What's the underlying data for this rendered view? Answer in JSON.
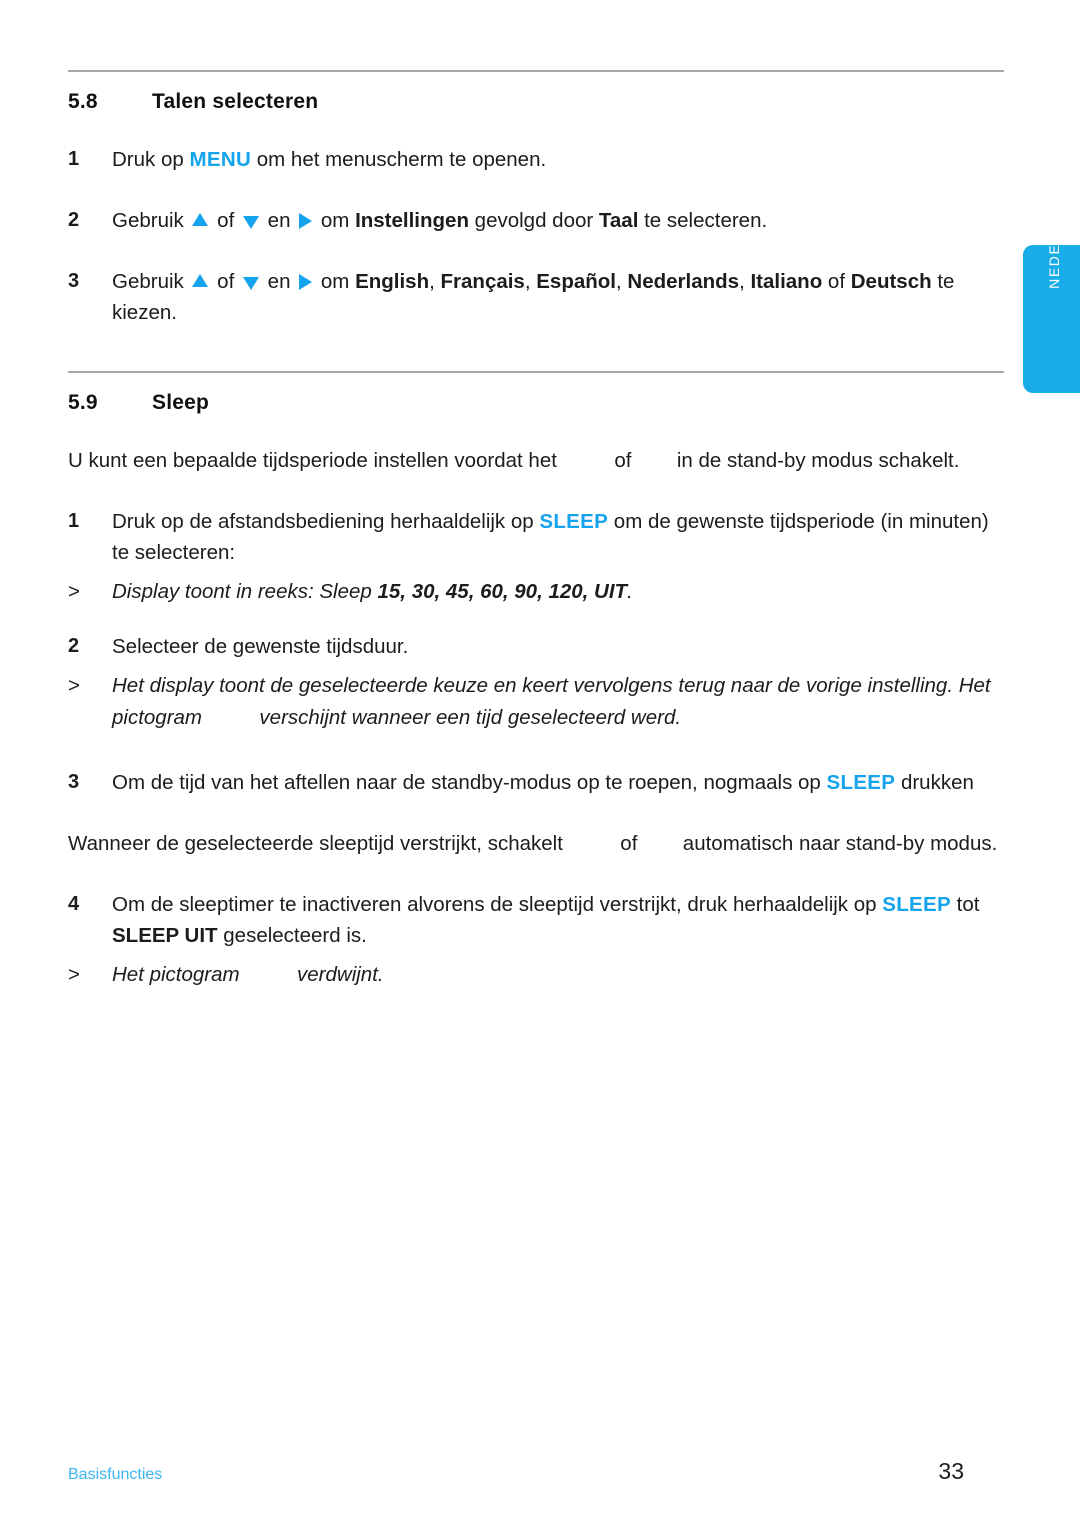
{
  "page": {
    "language_tab": "NEDERLANDS",
    "accent_color": "#14a3ec",
    "rule_color": "#a8a8a8"
  },
  "sections": [
    {
      "number": "5.8",
      "title": "Talen selecteren"
    },
    {
      "number": "5.9",
      "title": "Sleep"
    }
  ],
  "s58": {
    "step1": {
      "num": "1",
      "pre": "Druk op ",
      "key": "MENU",
      "post": " om het menuscherm te openen."
    },
    "step2": {
      "num": "2",
      "t1": "Gebruik ",
      "t2": " of ",
      "t3": " en ",
      "t4": " om ",
      "b1": "Instellingen",
      "t5": " gevolgd door ",
      "b2": "Taal",
      "t6": " te selecteren."
    },
    "step3": {
      "num": "3",
      "t1": "Gebruik ",
      "t2": " of ",
      "t3": " en ",
      "t4": " om ",
      "b1": "English",
      "sep1": ", ",
      "b2": "Français",
      "sep2": ", ",
      "b3": "Español",
      "sep3": ", ",
      "b4": "Nederlands",
      "sep4": ", ",
      "b5": "Italiano",
      "t5": " of ",
      "b6": "Deutsch",
      "t6": " te kiezen."
    }
  },
  "s59": {
    "intro": {
      "t1": "U kunt een bepaalde tijdsperiode instellen voordat het ",
      "t2": " of ",
      "t3": " in de stand-by modus schakelt."
    },
    "step1": {
      "num": "1",
      "pre": "Druk op de afstandsbediening herhaaldelijk op ",
      "key": "SLEEP",
      "post": " om de gewenste tijdsperiode (in minuten) te selecteren:"
    },
    "result1": {
      "marker": ">",
      "pre": "Display toont in reeks: Sleep ",
      "values": "15, 30, 45, 60, 90, 120, UIT",
      "post": "."
    },
    "step2": {
      "num": "2",
      "text": "Selecteer de gewenste tijdsduur."
    },
    "result2": {
      "marker": ">",
      "t1": "Het display toont de geselecteerde keuze en keert vervolgens terug naar de vorige instelling. Het pictogram ",
      "t2": " verschijnt wanneer een tijd geselecteerd werd."
    },
    "step3": {
      "num": "3",
      "pre": "Om de tijd van het aftellen naar de standby-modus op te roepen, nogmaals op ",
      "key": "SLEEP",
      "post": " drukken"
    },
    "para2": {
      "t1": "Wanneer de geselecteerde sleeptijd verstrijkt, schakelt ",
      "t2": " of ",
      "t3": " automatisch naar stand-by modus."
    },
    "step4": {
      "num": "4",
      "pre": "Om de sleeptimer te inactiveren alvorens de sleeptijd verstrijkt, druk herhaaldelijk op ",
      "key": "SLEEP",
      "mid": " tot ",
      "bold": "SLEEP UIT",
      "post": " geselecteerd is."
    },
    "result3": {
      "marker": ">",
      "t1": "Het pictogram ",
      "t2": " verdwijnt."
    }
  },
  "footer": {
    "chapter": "Basisfuncties",
    "page_number": "33"
  }
}
